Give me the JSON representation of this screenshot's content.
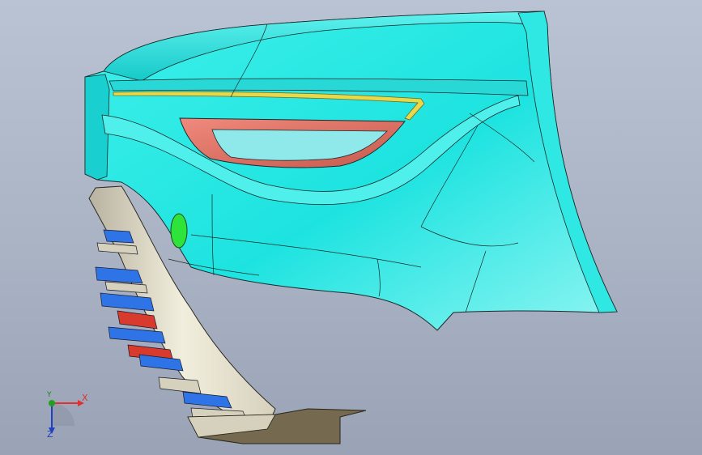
{
  "viewport": {
    "background_top": "#b9c3d3",
    "background_bottom": "#9aa3b6"
  },
  "model": {
    "body_color": "#1de3e0",
    "body_dark": "#13b6b8",
    "light_color": "#e7796b",
    "trim_color": "#e8e3cf",
    "strip_color": "#e8d84c",
    "reflector_color": "#2ee33a",
    "fin_blue": "#2f74e6",
    "fin_red": "#d83a2e",
    "edge_color": "#1a2a2a"
  },
  "triad": {
    "x_label": "X",
    "y_label": "Y",
    "z_label": "Z",
    "x_color": "#e03030",
    "y_color": "#20a020",
    "z_color": "#2040c0"
  }
}
